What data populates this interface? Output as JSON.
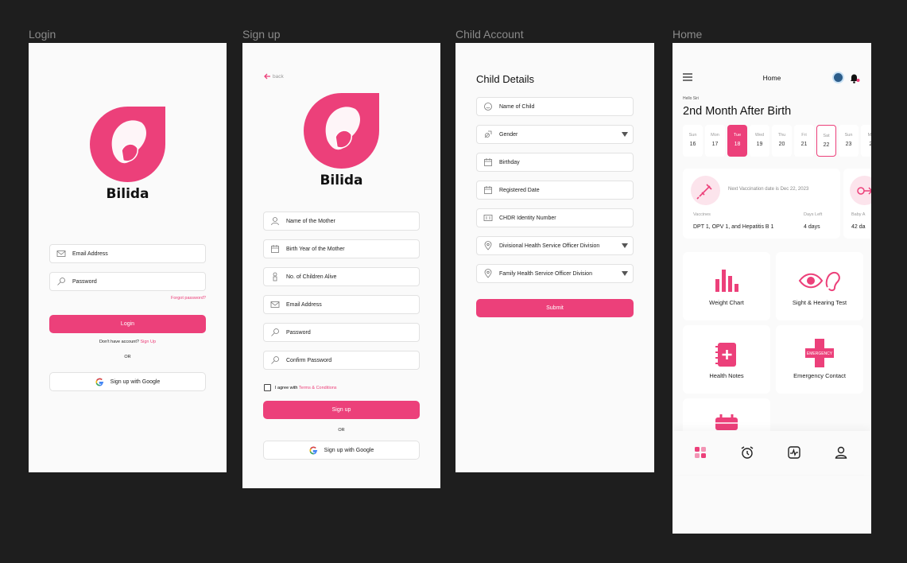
{
  "frames": {
    "login": "Login",
    "signup": "Sign up",
    "child": "Child Account",
    "home": "Home"
  },
  "brand": "Bilida",
  "login": {
    "email": "Email Address",
    "password": "Password",
    "forgot": "Forgot password?",
    "login_btn": "Login",
    "no_account": "Don't have account? ",
    "sign_up_link": "Sign Up",
    "or": "OR",
    "google": "Sign up with Google"
  },
  "signup": {
    "back": "back",
    "fields": [
      "Name of the Mother",
      "Birth Year of the Mother",
      "No. of Children Alive",
      "Email Address",
      "Password",
      "Confirm Password"
    ],
    "agree": "I agree with ",
    "terms": "Terms & Conditions",
    "signup_btn": "Sign up",
    "or": "OR",
    "google": "Sign up with Google"
  },
  "child": {
    "title": "Child Details",
    "fields": [
      "Name of Child",
      "Gender",
      "Birthday",
      "Registered Date",
      "CHDR Identity Number",
      "Divisional Health Service Officer Division",
      "Family Health Service Officer Division"
    ],
    "submit": "Submit"
  },
  "home": {
    "header": "Home",
    "hello": "Hello Siri",
    "heading": "2nd Month After Birth",
    "days": [
      {
        "n": "Sun",
        "d": "16"
      },
      {
        "n": "Mon",
        "d": "17"
      },
      {
        "n": "Tue",
        "d": "18"
      },
      {
        "n": "Wed",
        "d": "19"
      },
      {
        "n": "Thu",
        "d": "20"
      },
      {
        "n": "Fri",
        "d": "21"
      },
      {
        "n": "Sat",
        "d": "22"
      },
      {
        "n": "Sun",
        "d": "23"
      },
      {
        "n": "Mo",
        "d": "2"
      }
    ],
    "vacc_next": "Next Vaccination date is Dec 22, 2023",
    "vacc_label": "Vaccines",
    "vacc_value": "DPT 1, OPV 1, and Hepatitis B 1",
    "days_left_label": "Days Left",
    "days_left_value": "4 days",
    "card2_label": "Baby A",
    "card2_value": "42 da",
    "tiles": [
      "Weight Chart",
      "Sight & Hearing Test",
      "Health Notes",
      "Emergency Contact"
    ],
    "emergency_text": "EMERGENCY"
  },
  "colors": {
    "accent": "#ec407a",
    "bg": "#1e1e1e"
  }
}
